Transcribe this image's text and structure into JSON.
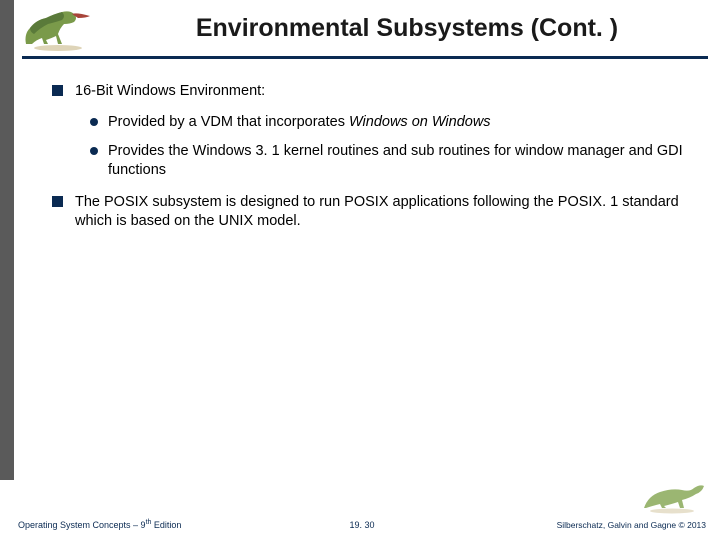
{
  "title": "Environmental Subsystems (Cont. )",
  "bullets": [
    {
      "text": "16-Bit Windows Environment:",
      "subs": [
        {
          "prefix": "Provided by a VDM that incorporates ",
          "italic": "Windows on Windows",
          "suffix": ""
        },
        {
          "prefix": "Provides the Windows 3. 1 kernel routines and sub routines for window manager and GDI functions",
          "italic": "",
          "suffix": ""
        }
      ]
    },
    {
      "text": "The POSIX subsystem is designed to run POSIX applications following the POSIX. 1 standard which is based on the UNIX model.",
      "subs": []
    }
  ],
  "footer": {
    "left_a": "Operating System Concepts – 9",
    "left_sup": "th",
    "left_b": " Edition",
    "center": "19. 30",
    "right": "Silberschatz, Galvin and Gagne © 2013"
  }
}
